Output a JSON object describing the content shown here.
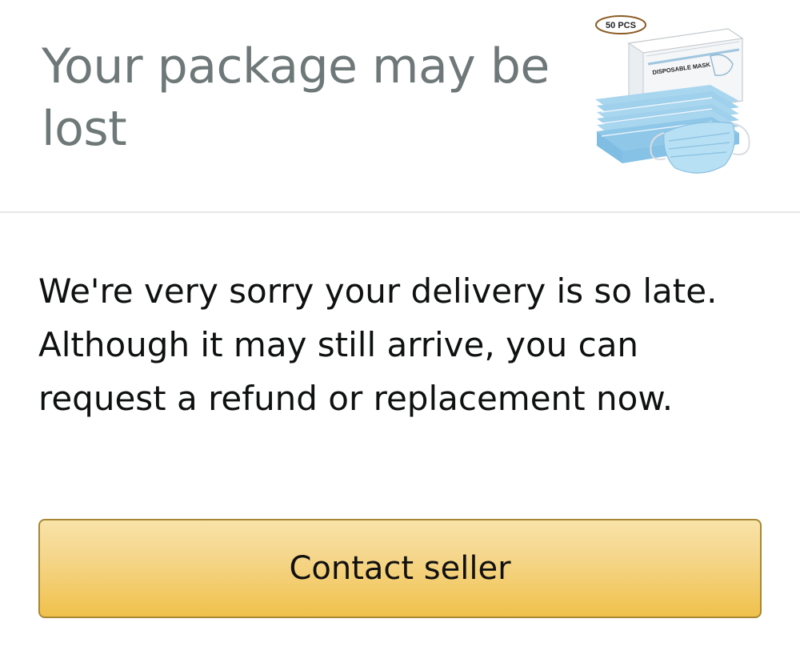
{
  "header": {
    "title": "Your package may be lost"
  },
  "product": {
    "image_icon": "disposable-face-mask-box-product-image",
    "box_badge": "50 PCS",
    "box_label": "DISPOSABLE MASK"
  },
  "message": {
    "text": "We're very sorry your delivery is so late. Although it may still arrive, you can request a refund or replacement now."
  },
  "actions": {
    "contact_seller_label": "Contact seller",
    "button_color": "#f0c14b"
  }
}
